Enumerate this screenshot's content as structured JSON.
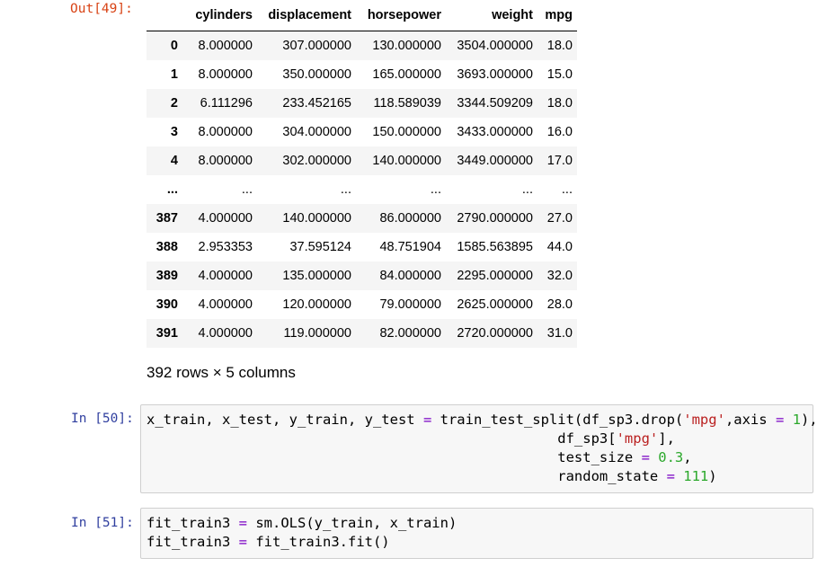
{
  "out49": {
    "prompt": "Out[49]:",
    "columns": [
      "",
      "cylinders",
      "displacement",
      "horsepower",
      "weight",
      "mpg"
    ],
    "rows": [
      [
        "0",
        "8.000000",
        "307.000000",
        "130.000000",
        "3504.000000",
        "18.0"
      ],
      [
        "1",
        "8.000000",
        "350.000000",
        "165.000000",
        "3693.000000",
        "15.0"
      ],
      [
        "2",
        "6.111296",
        "233.452165",
        "118.589039",
        "3344.509209",
        "18.0"
      ],
      [
        "3",
        "8.000000",
        "304.000000",
        "150.000000",
        "3433.000000",
        "16.0"
      ],
      [
        "4",
        "8.000000",
        "302.000000",
        "140.000000",
        "3449.000000",
        "17.0"
      ],
      [
        "...",
        "...",
        "...",
        "...",
        "...",
        "..."
      ],
      [
        "387",
        "4.000000",
        "140.000000",
        "86.000000",
        "2790.000000",
        "27.0"
      ],
      [
        "388",
        "2.953353",
        "37.595124",
        "48.751904",
        "1585.563895",
        "44.0"
      ],
      [
        "389",
        "4.000000",
        "135.000000",
        "84.000000",
        "2295.000000",
        "32.0"
      ],
      [
        "390",
        "4.000000",
        "120.000000",
        "79.000000",
        "2625.000000",
        "28.0"
      ],
      [
        "391",
        "4.000000",
        "119.000000",
        "82.000000",
        "2720.000000",
        "31.0"
      ]
    ],
    "shape_text": "392 rows × 5 columns"
  },
  "in50": {
    "prompt": "In [50]:",
    "line1": {
      "a": "x_train, x_test, y_train, y_test ",
      "eq": "=",
      "b": " train_test_split(df_sp3.drop(",
      "s": "'mpg'",
      "c": ",axis ",
      "eq2": "=",
      "d": " ",
      "n": "1",
      "e": "),"
    },
    "line2": {
      "a": "                                                 df_sp3[",
      "s": "'mpg'",
      "b": "],"
    },
    "line3": {
      "a": "                                                 test_size ",
      "eq": "=",
      "b": " ",
      "n": "0.3",
      "c": ","
    },
    "line4": {
      "a": "                                                 random_state ",
      "eq": "=",
      "b": " ",
      "n": "111",
      "c": ")"
    }
  },
  "in51": {
    "prompt": "In [51]:",
    "line1": {
      "a": "fit_train3 ",
      "eq": "=",
      "b": " sm.OLS(y_train, x_train)"
    },
    "line2": {
      "a": "fit_train3 ",
      "eq": "=",
      "b": " fit_train3.fit()"
    }
  }
}
